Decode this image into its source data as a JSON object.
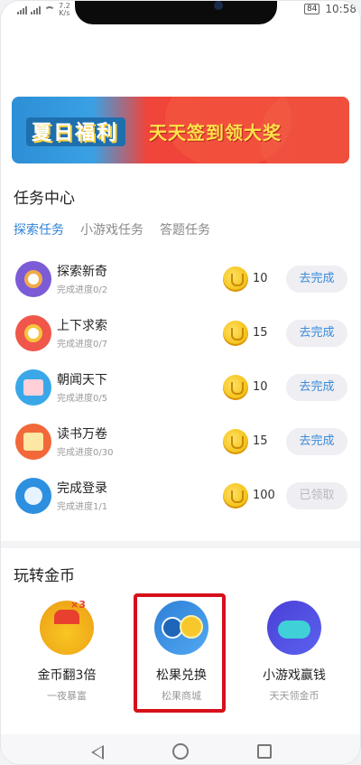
{
  "status_bar": {
    "speed": "7.2",
    "speed_unit": "K/s",
    "battery": "84",
    "time": "10:58"
  },
  "banner": {
    "title": "夏日福利",
    "subtitle": "天天签到领大奖"
  },
  "task_center": {
    "title": "任务中心",
    "tabs": [
      {
        "label": "探索任务",
        "active": true
      },
      {
        "label": "小游戏任务",
        "active": false
      },
      {
        "label": "答题任务",
        "active": false
      }
    ],
    "tasks": [
      {
        "name": "探索新奇",
        "progress": "完成进度0/2",
        "reward": "10",
        "button": "去完成",
        "icon": "search-explore-icon",
        "color": "#7b5cd6"
      },
      {
        "name": "上下求索",
        "progress": "完成进度0/7",
        "reward": "15",
        "button": "去完成",
        "icon": "search-ring-icon",
        "color": "#f0564a"
      },
      {
        "name": "朝闻天下",
        "progress": "完成进度0/5",
        "reward": "10",
        "button": "去完成",
        "icon": "news-icon",
        "color": "#3aa8e8"
      },
      {
        "name": "读书万卷",
        "progress": "完成进度0/30",
        "reward": "15",
        "button": "去完成",
        "icon": "book-icon",
        "color": "#f2683a"
      },
      {
        "name": "完成登录",
        "progress": "完成进度1/1",
        "reward": "100",
        "button": "已领取",
        "icon": "login-shield-icon",
        "color": "#2d8fe0"
      }
    ]
  },
  "coins_section": {
    "title": "玩转金币",
    "items": [
      {
        "name": "金币翻3倍",
        "sub": "一夜暴富",
        "icon": "coin-flip-icon",
        "badge": "×3"
      },
      {
        "name": "松果兑换",
        "sub": "松果商城",
        "icon": "pinecone-exchange-icon"
      },
      {
        "name": "小游戏赢钱",
        "sub": "天天领金币",
        "icon": "gamepad-icon"
      }
    ]
  },
  "nav_bar": {
    "back": "back-icon",
    "home": "home-icon",
    "recent": "recent-apps-icon"
  }
}
